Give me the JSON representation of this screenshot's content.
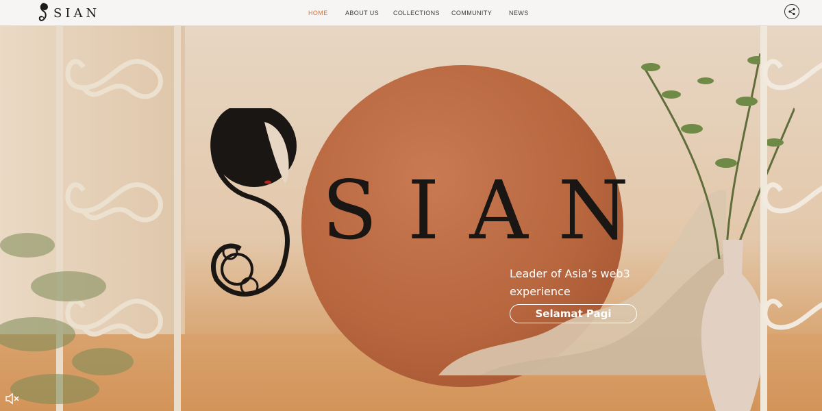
{
  "header": {
    "brand_text": "SIAN",
    "nav": [
      {
        "label": "HOME",
        "active": true
      },
      {
        "label": "ABOUT US"
      },
      {
        "label": "COLLECTIONS"
      },
      {
        "label": "COMMUNITY"
      },
      {
        "label": "NEWS"
      }
    ],
    "share_icon": "share-icon",
    "active_color": "#d96c3a"
  },
  "hero": {
    "logo_text": "SIAN",
    "tagline": "Leader of Asia’s web3 experience",
    "cta_label": "Selamat Pagi",
    "mute_icon": "speaker-muted-icon"
  }
}
